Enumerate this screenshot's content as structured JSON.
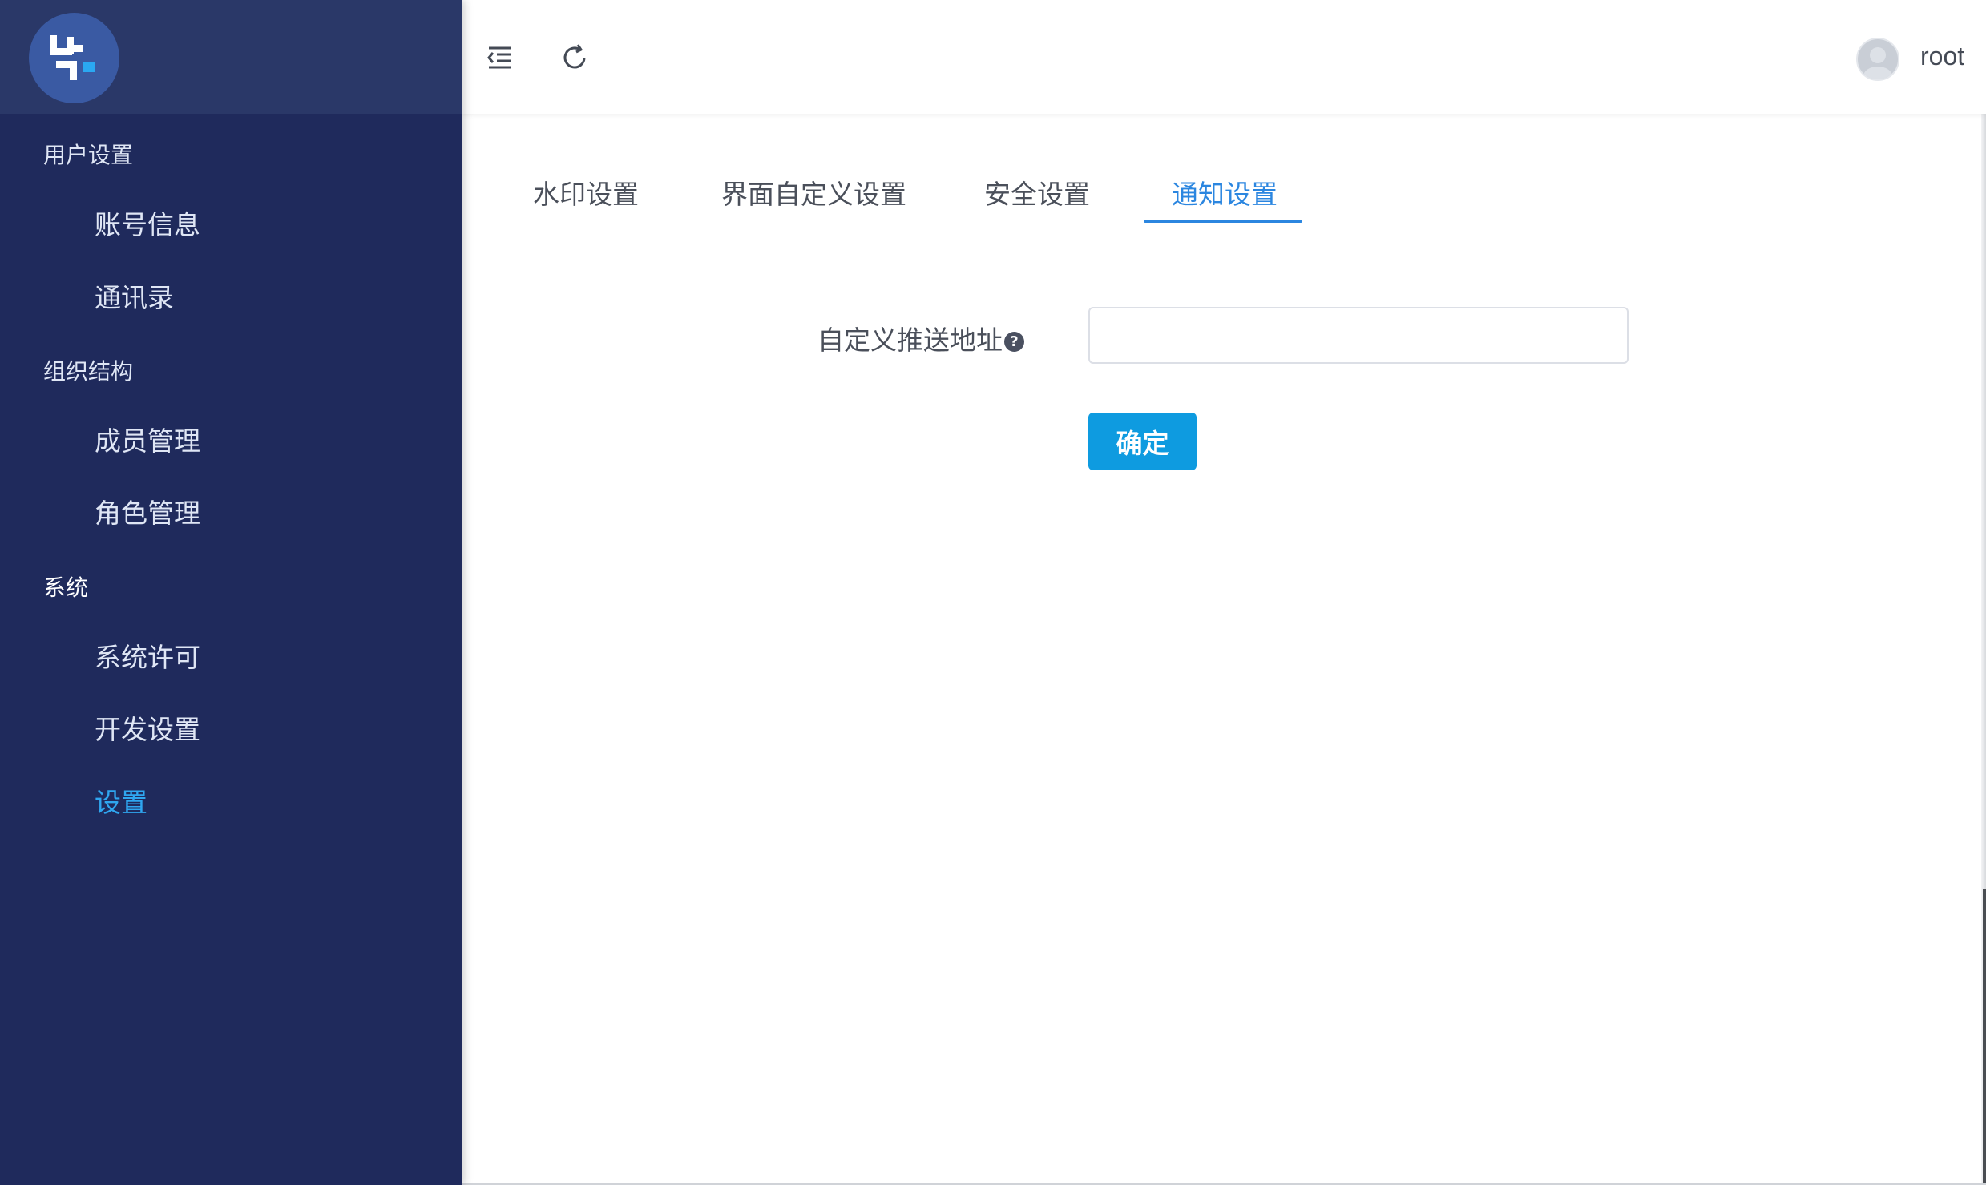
{
  "sidebar": {
    "groups": [
      {
        "title": "用户设置",
        "items": [
          "账号信息",
          "通讯录"
        ]
      },
      {
        "title": "组织结构",
        "items": [
          "成员管理",
          "角色管理"
        ]
      },
      {
        "title": "系统",
        "items": [
          "系统许可",
          "开发设置",
          "设置"
        ]
      }
    ],
    "active_item": "设置"
  },
  "topbar": {
    "icons": [
      "menu-collapse-icon",
      "refresh-icon"
    ],
    "username": "root"
  },
  "tabs": [
    "水印设置",
    "界面自定义设置",
    "安全设置",
    "通知设置"
  ],
  "active_tab": "通知设置",
  "form": {
    "label": "自定义推送地址",
    "help_symbol": "?",
    "input_value": "",
    "confirm_label": "确定"
  },
  "colors": {
    "sidebar_bg": "#1f2a5c",
    "accent": "#2b86e0",
    "button": "#0e9be0",
    "active_nav": "#2fa6f0"
  }
}
